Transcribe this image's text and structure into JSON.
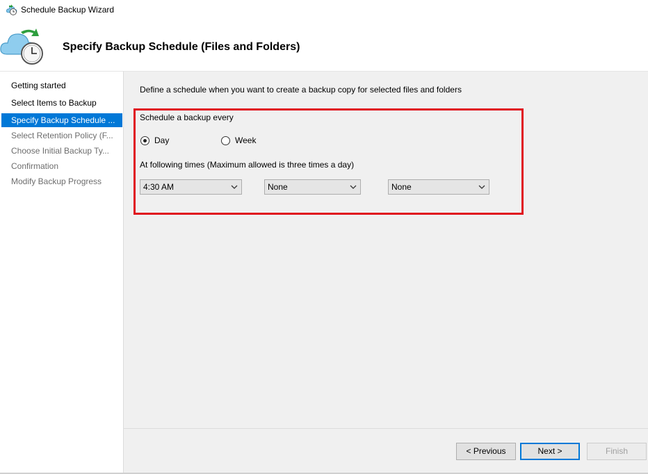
{
  "window": {
    "title": "Schedule Backup Wizard"
  },
  "header": {
    "heading": "Specify Backup Schedule (Files and Folders)"
  },
  "sidebar": {
    "items": [
      {
        "label": "Getting started",
        "state": "normal"
      },
      {
        "label": "Select Items to Backup",
        "state": "normal"
      },
      {
        "label": "Specify Backup Schedule ...",
        "state": "active"
      },
      {
        "label": "Select Retention Policy (F...",
        "state": "disabled"
      },
      {
        "label": "Choose Initial Backup Ty...",
        "state": "disabled"
      },
      {
        "label": "Confirmation",
        "state": "disabled"
      },
      {
        "label": "Modify Backup Progress",
        "state": "disabled"
      }
    ]
  },
  "main": {
    "description": "Define a schedule when you want to create a backup copy for selected files and folders",
    "schedule_label": "Schedule a backup every",
    "frequency": {
      "options": [
        {
          "label": "Day",
          "checked": true
        },
        {
          "label": "Week",
          "checked": false
        }
      ]
    },
    "times_label": "At following times (Maximum allowed is three times a day)",
    "time_selects": [
      {
        "value": "4:30 AM"
      },
      {
        "value": "None"
      },
      {
        "value": "None"
      }
    ],
    "highlight_color": "#e0101e"
  },
  "footer": {
    "previous_label": "< Previous",
    "next_label": "Next >",
    "finish_label": "Finish"
  },
  "colors": {
    "accent": "#0078d7"
  }
}
